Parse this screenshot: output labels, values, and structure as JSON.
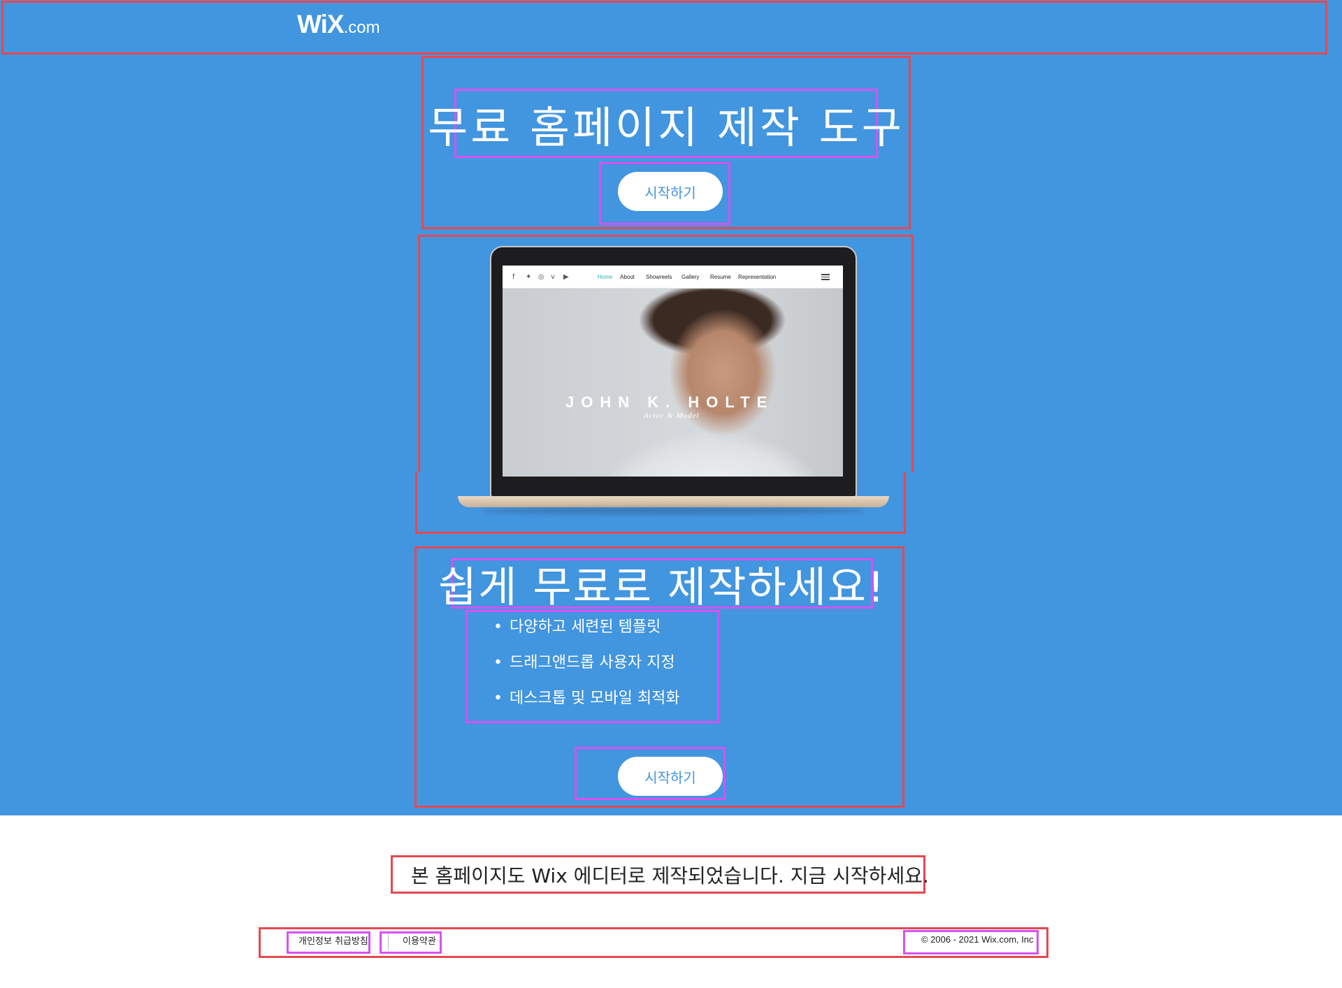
{
  "header": {
    "logo_main": "WiX",
    "logo_suffix": ".com"
  },
  "hero": {
    "title": "무료 홈페이지 제작 도구",
    "cta_label": "시작하기"
  },
  "device_preview": {
    "nav_links": [
      "Home",
      "About",
      "Showreels",
      "Gallery",
      "Resume",
      "Representation"
    ],
    "social_icons": [
      "facebook-icon",
      "twitter-icon",
      "instagram-icon",
      "vimeo-icon",
      "youtube-icon"
    ],
    "portrait_name": "JOHN K. HOLTE",
    "portrait_subtitle": "Actor & Model"
  },
  "features": {
    "title": "쉽게 무료로 제작하세요!",
    "items": [
      "다양하고 세련된 템플릿",
      "드래그앤드롭 사용자 지정",
      "데스크톱 및 모바일 최적화"
    ],
    "cta_label": "시작하기"
  },
  "footer": {
    "note": "본 홈페이지도 Wix 에디터로 제작되었습니다. 지금 시작하세요.",
    "privacy_label": "개인정보 취급방침",
    "terms_label": "이용약관",
    "copyright": "© 2006 - 2021 Wix.com, Inc"
  },
  "colors": {
    "background_blue": "#4295df",
    "highlight_red": "#e6484f",
    "highlight_pink": "#d651f2",
    "button_text": "#4295df"
  }
}
